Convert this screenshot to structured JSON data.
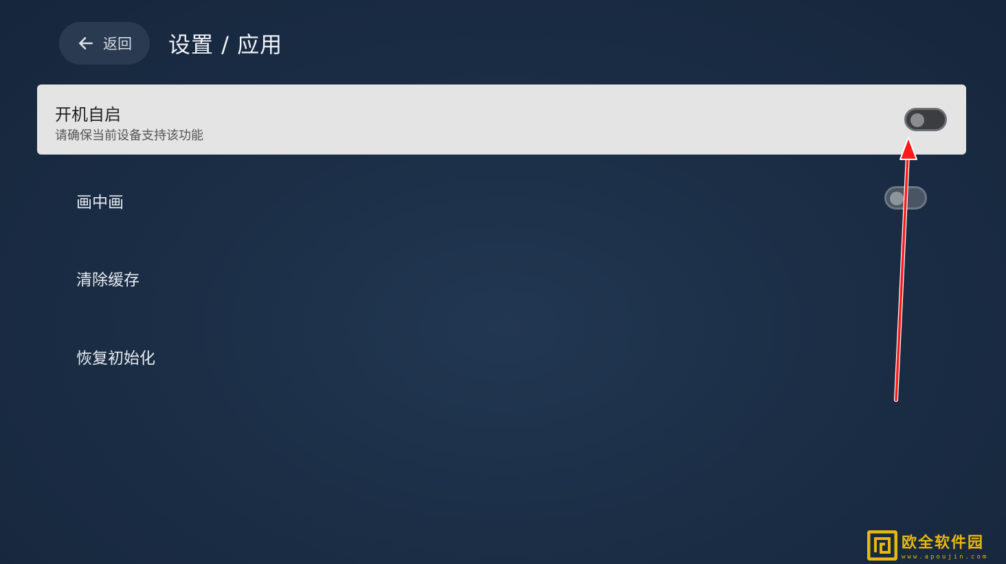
{
  "header": {
    "back_label": "返回",
    "title": "设置 / 应用",
    "back_icon": "arrow-left-icon"
  },
  "settings": {
    "items": [
      {
        "title": "开机自启",
        "subtitle": "请确保当前设备支持该功能",
        "has_toggle": true,
        "enabled": false,
        "focused": true
      },
      {
        "title": "画中画",
        "has_toggle": true,
        "enabled": false
      },
      {
        "title": "清除缓存",
        "has_toggle": false
      },
      {
        "title": "恢复初始化",
        "has_toggle": false
      }
    ]
  },
  "annotation": {
    "arrow_color": "#ff1a1a",
    "arrow_icon": "red-arrow-annotation"
  },
  "watermark": {
    "name": "欧全软件园",
    "url": "www.apoujin.com",
    "color": "#e9b80e",
    "logo_icon": "square-spiral-logo-icon"
  }
}
